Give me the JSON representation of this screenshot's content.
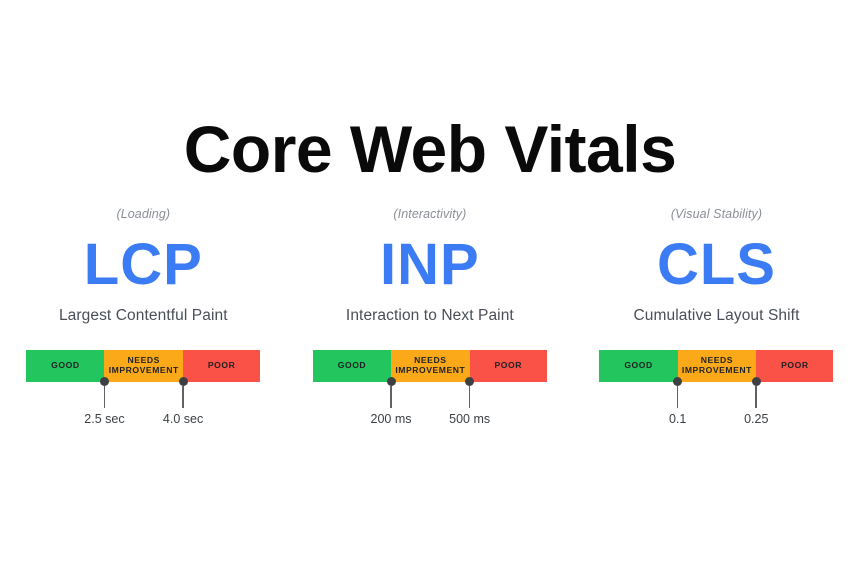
{
  "title": "Core Web Vitals",
  "segment_labels": {
    "good": "GOOD",
    "needs_improvement": "NEEDS\nIMPROVEMENT",
    "poor": "POOR"
  },
  "colors": {
    "good": "#23c55e",
    "needs_improvement": "#fba919",
    "poor": "#fa5246",
    "accent_blue": "#3b7cf4",
    "title_text": "#0a0a0a",
    "category_text": "#8a8f96",
    "fullname_text": "#4a4f57",
    "marker": "#3c4043",
    "background": "#ffffff"
  },
  "metrics": [
    {
      "category": "(Loading)",
      "acronym": "LCP",
      "fullname": "Largest Contentful Paint",
      "thresholds": [
        {
          "label": "2.5 sec",
          "position_pct": 33.4
        },
        {
          "label": "4.0 sec",
          "position_pct": 67.0
        }
      ]
    },
    {
      "category": "(Interactivity)",
      "acronym": "INP",
      "fullname": "Interaction to Next Paint",
      "thresholds": [
        {
          "label": "200 ms",
          "position_pct": 33.4
        },
        {
          "label": "500 ms",
          "position_pct": 67.0
        }
      ]
    },
    {
      "category": "(Visual Stability)",
      "acronym": "CLS",
      "fullname": "Cumulative Layout Shift",
      "thresholds": [
        {
          "label": "0.1",
          "position_pct": 33.4
        },
        {
          "label": "0.25",
          "position_pct": 67.0
        }
      ]
    }
  ],
  "chart_data": {
    "type": "bar",
    "title": "Core Web Vitals",
    "categories": [
      "LCP",
      "INP",
      "CLS"
    ],
    "series": [
      {
        "name": "GOOD",
        "values": [
          "< 2.5 sec",
          "< 200 ms",
          "< 0.1"
        ]
      },
      {
        "name": "NEEDS IMPROVEMENT",
        "values": [
          "2.5 - 4.0 sec",
          "200 - 500 ms",
          "0.1 - 0.25"
        ]
      },
      {
        "name": "POOR",
        "values": [
          "> 4.0 sec",
          "> 500 ms",
          "> 0.25"
        ]
      }
    ],
    "legend_position": "inline",
    "grid": false,
    "xlabel": "",
    "ylabel": ""
  }
}
